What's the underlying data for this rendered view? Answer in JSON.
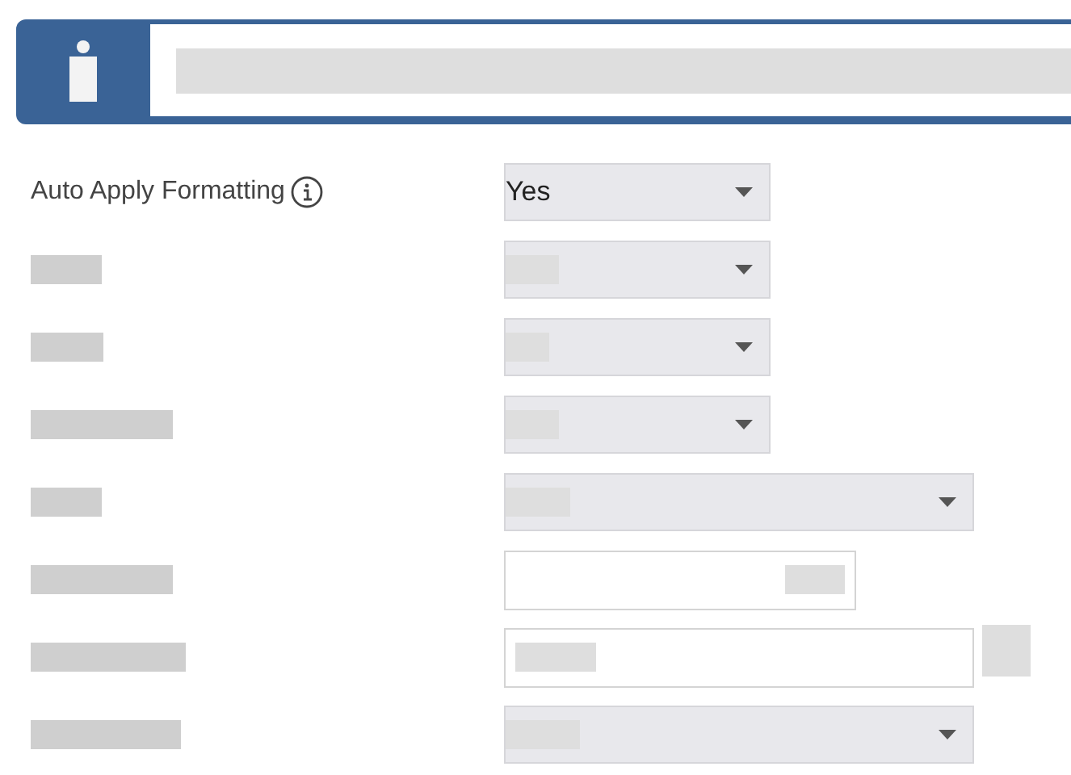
{
  "banner": {
    "kind": "info"
  },
  "rows": [
    {
      "label": "Auto Apply Formatting",
      "info": true,
      "kind": "select",
      "value": "Yes"
    },
    {
      "kind": "select"
    },
    {
      "kind": "select"
    },
    {
      "kind": "select"
    },
    {
      "kind": "longselect"
    },
    {
      "kind": "input"
    },
    {
      "kind": "longinput",
      "button": true
    },
    {
      "kind": "longselect"
    }
  ]
}
